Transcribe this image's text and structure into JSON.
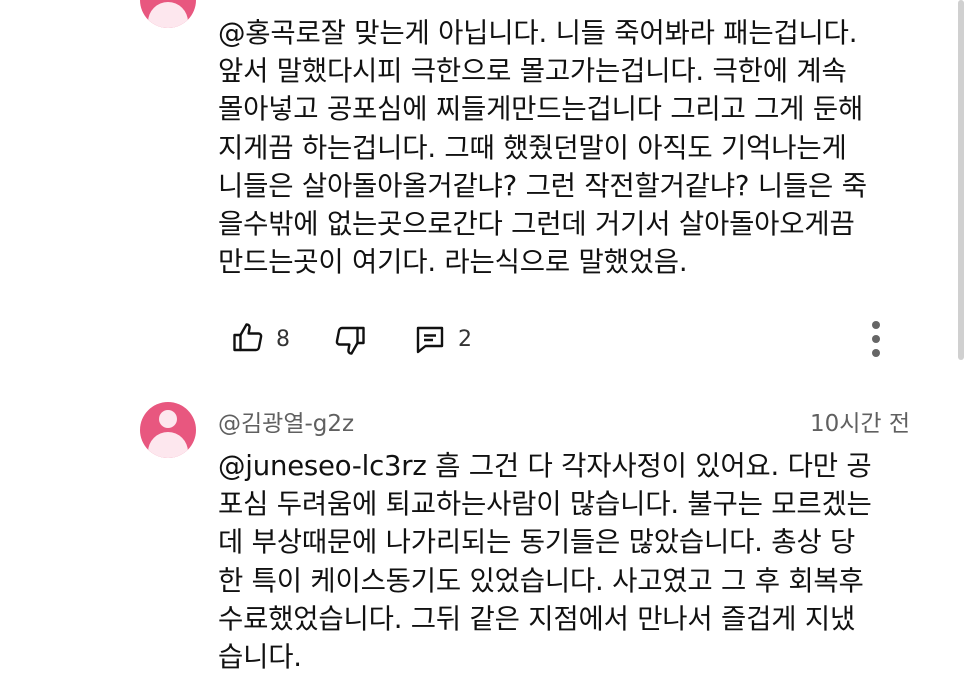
{
  "comment1": {
    "text": "@홍곡로잘 맞는게 아닙니다. 니들 죽어봐라 패는겁니다.\n앞서 말했다시피 극한으로 몰고가는겁니다. 극한에 계속\n몰아넣고 공포심에 찌들게만드는겁니다 그리고 그게 둔해\n지게끔 하는겁니다. 그때 했줬던말이 아직도 기억나는게\n니들은 살아돌아올거같냐? 그런 작전할거같냐? 니들은 죽\n을수밖에 없는곳으로간다 그런데 거기서 살아돌아오게끔\n만드는곳이 여기다.  라는식으로 말했었음.",
    "likes": "8",
    "replies": "2"
  },
  "comment2": {
    "author": "@김광열-g2z",
    "time": "10시간 전",
    "text": "@juneseo-lc3rz 흠 그건 다 각자사정이 있어요. 다만 공\n포심 두려움에 퇴교하는사람이 많습니다. 불구는 모르겠는\n데 부상때문에 나가리되는 동기들은 많았습니다.  총상 당\n한 특이 케이스동기도 있었습니다. 사고였고 그 후 회복후\n수료했었습니다. 그뒤 같은 지점에서 만나서 즐겁게 지냈\n습니다."
  },
  "colors": {
    "avatar": "#e8577f",
    "avatar_figure": "#fde7ee",
    "meta_text": "#606060"
  },
  "icons": [
    "thumbs-up-icon",
    "thumbs-down-icon",
    "reply-icon",
    "more-vert-icon"
  ]
}
